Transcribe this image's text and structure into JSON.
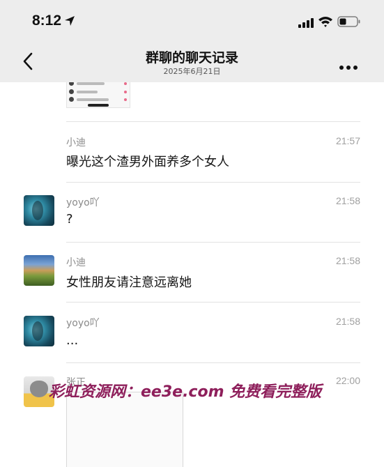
{
  "status_bar": {
    "time": "8:12"
  },
  "nav": {
    "title": "群聊的聊天记录",
    "subtitle": "2025年6月21日"
  },
  "messages": [
    {
      "sender": "小迪",
      "time": "21:57",
      "text": "曝光这个渣男外面养多个女人"
    },
    {
      "sender": "yoyo吖",
      "time": "21:58",
      "text": "?"
    },
    {
      "sender": "小迪",
      "time": "21:58",
      "text": "女性朋友请注意远离她"
    },
    {
      "sender": "yoyo吖",
      "time": "21:58",
      "text": "..."
    },
    {
      "sender": "张正",
      "time": "22:00",
      "text": ""
    }
  ],
  "watermark": "彩虹资源网：ee3e.com 免费看完整版",
  "colors": {
    "header_bg": "#ededed",
    "watermark": "#8e1f5b"
  },
  "icons": [
    "location-arrow-icon",
    "signal-icon",
    "wifi-icon",
    "battery-icon",
    "back-chevron-icon",
    "more-dots-icon"
  ]
}
